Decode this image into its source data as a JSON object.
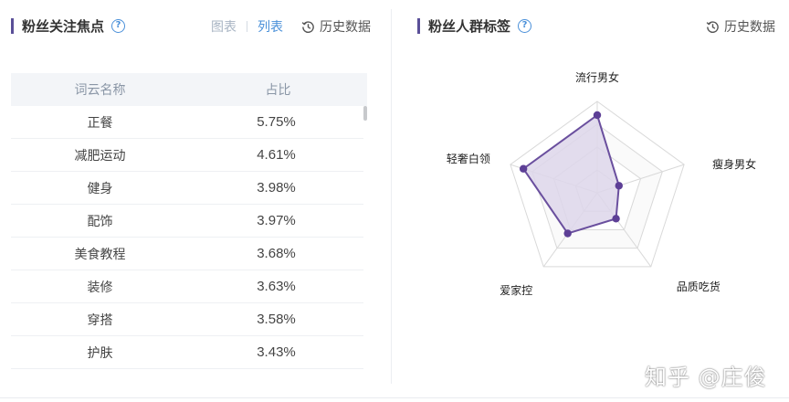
{
  "left_panel": {
    "title": "粉丝关注焦点",
    "help_icon": "?",
    "toolbar": {
      "chart_label": "图表",
      "list_label": "列表",
      "history_label": "历史数据"
    },
    "table": {
      "headers": [
        "词云名称",
        "占比"
      ],
      "rows": [
        [
          "正餐",
          "5.75%"
        ],
        [
          "减肥运动",
          "4.61%"
        ],
        [
          "健身",
          "3.98%"
        ],
        [
          "配饰",
          "3.97%"
        ],
        [
          "美食教程",
          "3.68%"
        ],
        [
          "装修",
          "3.63%"
        ],
        [
          "穿搭",
          "3.58%"
        ],
        [
          "护肤",
          "3.43%"
        ]
      ]
    }
  },
  "right_panel": {
    "title": "粉丝人群标签",
    "help_icon": "?",
    "toolbar": {
      "history_label": "历史数据"
    }
  },
  "chart_data": {
    "type": "radar",
    "categories": [
      "流行男女",
      "瘦身男女",
      "品质吃货",
      "爱家控",
      "轻奢白领"
    ],
    "values": [
      0.85,
      0.25,
      0.35,
      0.55,
      0.85
    ],
    "max": 1,
    "colors": {
      "fill": "#ddd6ea",
      "line": "#6a4f9e",
      "point": "#5d3f96",
      "grid": "#d9d9d9"
    }
  },
  "watermark": "知乎 @庄俊",
  "colors": {
    "accent": "#4a90d9",
    "title_bar": "#5a4f98"
  }
}
